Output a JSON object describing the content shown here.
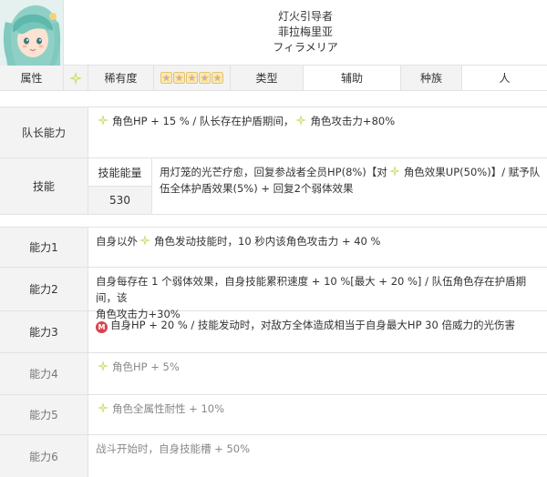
{
  "header": {
    "name_cn_title": "灯火引导者",
    "name_cn": "菲拉梅里亚",
    "name_jp": "フィラメリア"
  },
  "info": {
    "attribute_label": "属性",
    "rarity_label": "稀有度",
    "rarity_stars": 5,
    "type_label": "类型",
    "type_value": "辅助",
    "race_label": "种族",
    "race_value": "人"
  },
  "leader": {
    "label": "队长能力",
    "part1": "角色HP + 15 % / 队长存在护盾期间，",
    "part2": "角色攻击力+80%"
  },
  "skill": {
    "label": "技能",
    "energy_label": "技能能量",
    "energy_value": "530",
    "desc1": "用灯笼的光芒疗愈，回复参战者全员HP(8%)【对",
    "desc2": "角色效果UP(50%)】/ 赋予队",
    "desc3": "伍全体护盾效果(5%) + 回复2个弱体效果"
  },
  "abilities": [
    {
      "label": "能力1",
      "prefix": "自身以外",
      "text": "角色发动技能时，10 秒内该角色攻击力 + 40 %"
    },
    {
      "label": "能力2",
      "line1": "自身每存在 1 个弱体效果，自身技能累积速度 + 10 %[最大 + 20 %] / 队伍角色存在护盾期间，该",
      "line2": "角色攻击力+30%"
    },
    {
      "label": "能力3",
      "badge": "M",
      "text": "自身HP + 20 % / 技能发动时，对敌方全体造成相当于自身最大HP 30 倍威力的光伤害"
    },
    {
      "label": "能力4",
      "text": "角色HP + 5%"
    },
    {
      "label": "能力5",
      "text": "角色全属性耐性 + 10%"
    },
    {
      "label": "能力6",
      "text": "战斗开始时，自身技能槽 + 50%"
    }
  ],
  "colors": {
    "label_bg": "#f3f3f3",
    "border": "#e2e2e2",
    "spark": "#c6da62",
    "star": "#f2c84b",
    "star_inner": "#c9a0e8",
    "badge": "#d9434b"
  }
}
